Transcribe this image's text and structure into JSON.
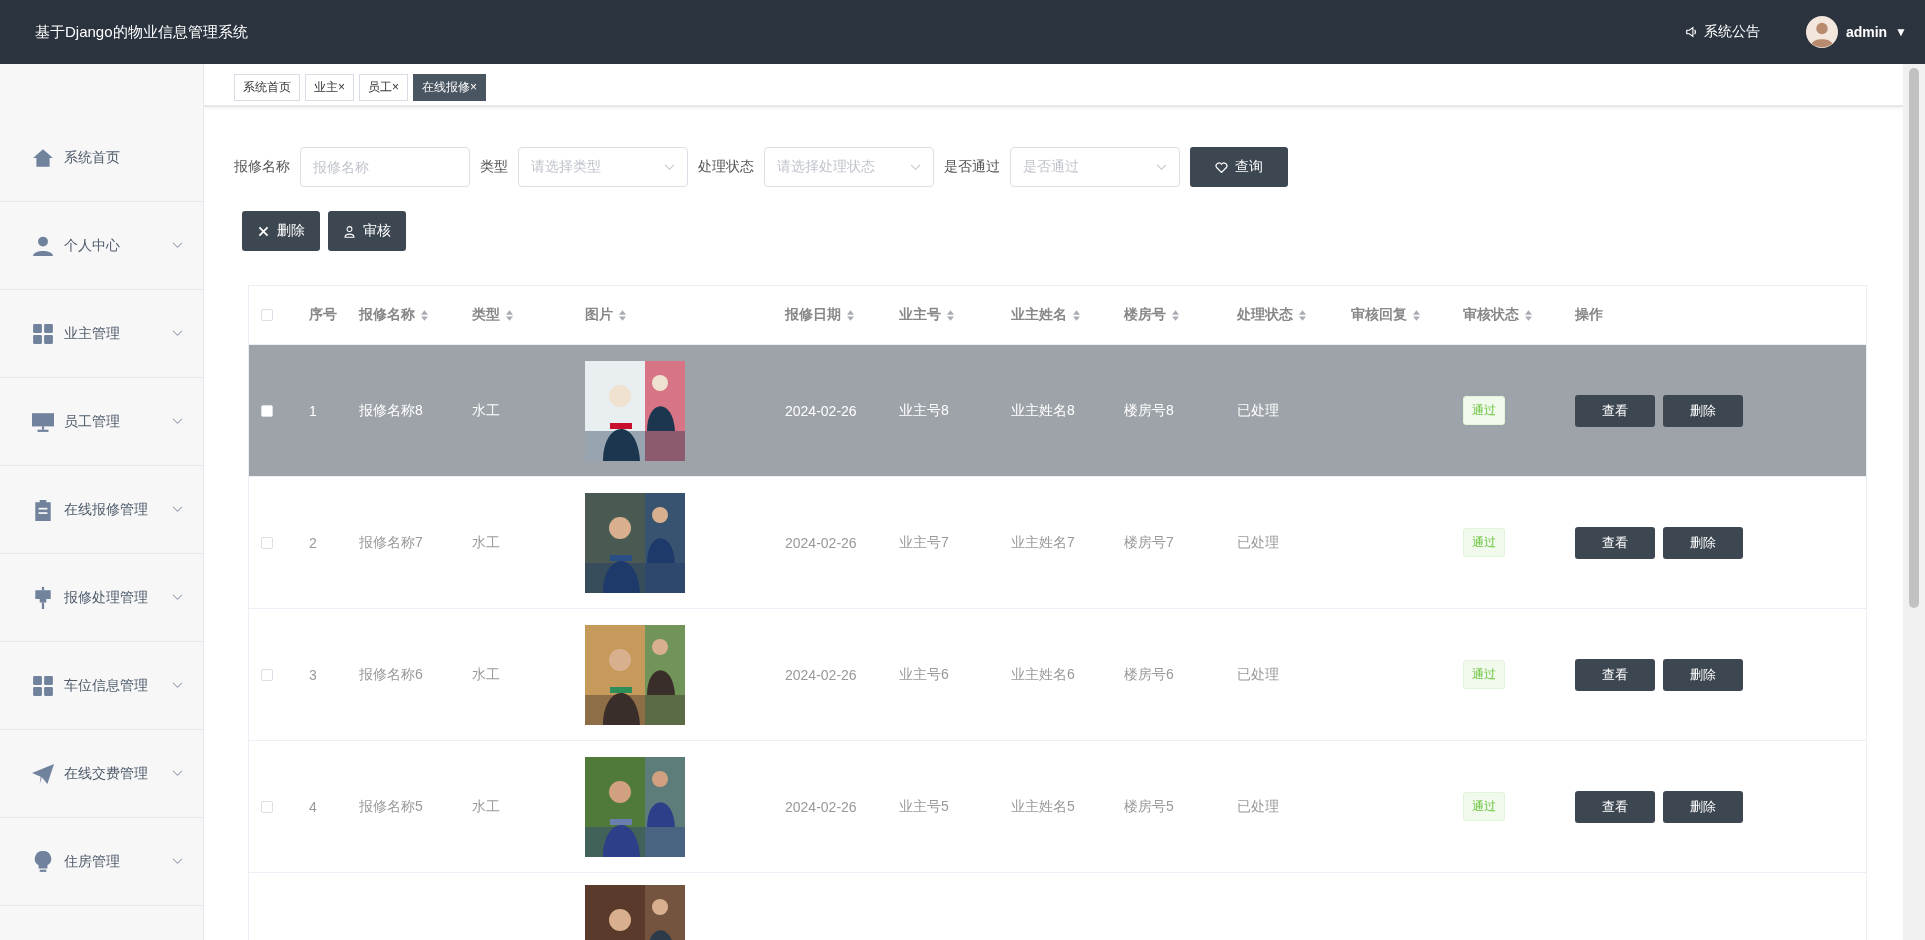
{
  "app": {
    "title": "基于Django的物业信息管理系统"
  },
  "header": {
    "notice": "系统公告",
    "user": "admin",
    "caret": "▼"
  },
  "sidebar": {
    "items": [
      {
        "label": "系统首页",
        "kind": "link"
      },
      {
        "label": "个人中心",
        "kind": "menu"
      },
      {
        "label": "业主管理",
        "kind": "menu"
      },
      {
        "label": "员工管理",
        "kind": "menu"
      },
      {
        "label": "在线报修管理",
        "kind": "menu"
      },
      {
        "label": "报修处理管理",
        "kind": "menu"
      },
      {
        "label": "车位信息管理",
        "kind": "menu"
      },
      {
        "label": "在线交费管理",
        "kind": "menu"
      },
      {
        "label": "住房管理",
        "kind": "menu"
      }
    ]
  },
  "tabs": [
    {
      "label": "系统首页",
      "selected": false
    },
    {
      "label": "业主",
      "close": "×",
      "selected": false
    },
    {
      "label": "员工",
      "close": "×",
      "selected": false
    },
    {
      "label": "在线报修",
      "close": "×",
      "selected": true
    }
  ],
  "filters": [
    {
      "label": "报修名称",
      "placeholder": "报修名称",
      "kind": "input"
    },
    {
      "label": "类型",
      "placeholder": "请选择类型",
      "kind": "select"
    },
    {
      "label": "处理状态",
      "placeholder": "请选择处理状态",
      "kind": "select"
    },
    {
      "label": "是否通过",
      "placeholder": "是否通过",
      "kind": "select"
    }
  ],
  "search_button": "查询",
  "actions": [
    {
      "label": "删除",
      "kind": "delete"
    },
    {
      "label": "审核",
      "kind": "audit"
    }
  ],
  "table": {
    "header_checked": false,
    "columns": [
      {
        "label": "序号",
        "sortable": false
      },
      {
        "label": "报修名称",
        "sortable": true
      },
      {
        "label": "类型",
        "sortable": true
      },
      {
        "label": "图片",
        "sortable": true
      },
      {
        "label": "报修日期",
        "sortable": true
      },
      {
        "label": "业主号",
        "sortable": true
      },
      {
        "label": "业主姓名",
        "sortable": true
      },
      {
        "label": "楼房号",
        "sortable": true
      },
      {
        "label": "处理状态",
        "sortable": true
      },
      {
        "label": "审核回复",
        "sortable": true
      },
      {
        "label": "审核状态",
        "sortable": true
      },
      {
        "label": "操作",
        "sortable": false
      }
    ],
    "rows": [
      {
        "selected": true,
        "checked": false,
        "index": "1",
        "name": "报修名称8",
        "type": "水工",
        "date": "2024-02-26",
        "owner_no": "业主号8",
        "owner_name": "业主姓名8",
        "building": "楼房号8",
        "process": "已处理",
        "audit": "通过",
        "buttons": [
          "查看",
          "删除"
        ]
      },
      {
        "selected": false,
        "checked": false,
        "index": "2",
        "name": "报修名称7",
        "type": "水工",
        "date": "2024-02-26",
        "owner_no": "业主号7",
        "owner_name": "业主姓名7",
        "building": "楼房号7",
        "process": "已处理",
        "audit": "通过",
        "buttons": [
          "查看",
          "删除"
        ]
      },
      {
        "selected": false,
        "checked": false,
        "index": "3",
        "name": "报修名称6",
        "type": "水工",
        "date": "2024-02-26",
        "owner_no": "业主号6",
        "owner_name": "业主姓名6",
        "building": "楼房号6",
        "process": "已处理",
        "audit": "通过",
        "buttons": [
          "查看",
          "删除"
        ]
      },
      {
        "selected": false,
        "checked": false,
        "index": "4",
        "name": "报修名称5",
        "type": "水工",
        "date": "2024-02-26",
        "owner_no": "业主号5",
        "owner_name": "业主姓名5",
        "building": "楼房号5",
        "process": "已处理",
        "audit": "通过",
        "buttons": [
          "查看",
          "删除"
        ]
      },
      {
        "selected": false,
        "kind": "partial"
      }
    ]
  }
}
